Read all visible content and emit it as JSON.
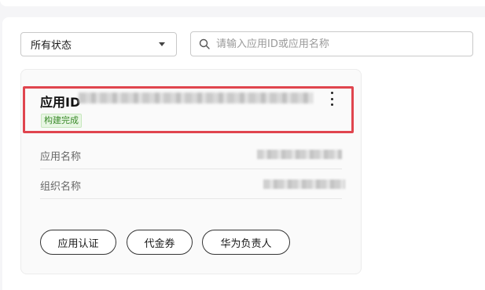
{
  "filters": {
    "status_value": "所有状态",
    "search_placeholder": "请输入应用ID或应用名称"
  },
  "card": {
    "app_id_label": "应用ID",
    "status_badge": "构建完成",
    "rows": [
      {
        "label": "应用名称"
      },
      {
        "label": "组织名称"
      }
    ],
    "actions": [
      {
        "label": "应用认证"
      },
      {
        "label": "代金券"
      },
      {
        "label": "华为负责人"
      }
    ]
  },
  "colors": {
    "highlight_border": "#e0454e",
    "badge_text": "#3a8a2a",
    "badge_bg": "#e8f6e4"
  }
}
